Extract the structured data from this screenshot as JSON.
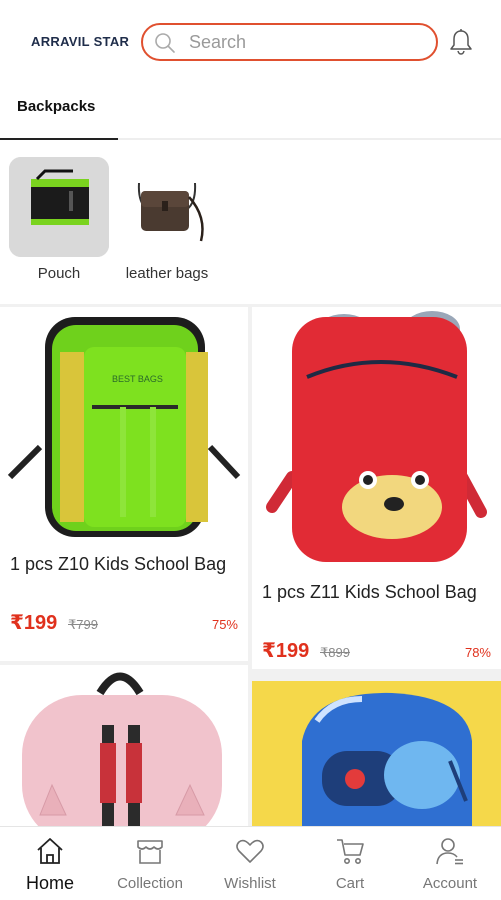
{
  "header": {
    "brand": "ARRAVIL STAR",
    "search_placeholder": "Search"
  },
  "tabs": [
    {
      "label": "Backpacks",
      "active": true
    }
  ],
  "categories": [
    {
      "label": "Pouch"
    },
    {
      "label": "leather bags"
    }
  ],
  "products": [
    {
      "name": "1 pcs Z10 Kids School Bag",
      "price": "₹199",
      "mrp": "₹799",
      "discount": "75%"
    },
    {
      "name": "1 pcs Z11 Kids School Bag",
      "price": "₹199",
      "mrp": "₹899",
      "discount": "78%"
    },
    {
      "name": "",
      "price": "",
      "mrp": "",
      "discount": ""
    },
    {
      "name": "",
      "price": "",
      "mrp": "",
      "discount": ""
    }
  ],
  "bottom_nav": [
    {
      "label": "Home",
      "icon": "home-icon",
      "active": true
    },
    {
      "label": "Collection",
      "icon": "store-icon",
      "active": false
    },
    {
      "label": "Wishlist",
      "icon": "heart-icon",
      "active": false
    },
    {
      "label": "Cart",
      "icon": "cart-icon",
      "active": false
    },
    {
      "label": "Account",
      "icon": "account-icon",
      "active": false
    }
  ],
  "colors": {
    "accent": "#e0502f",
    "price": "#e0311d",
    "brand_text": "#1f2d4a"
  }
}
